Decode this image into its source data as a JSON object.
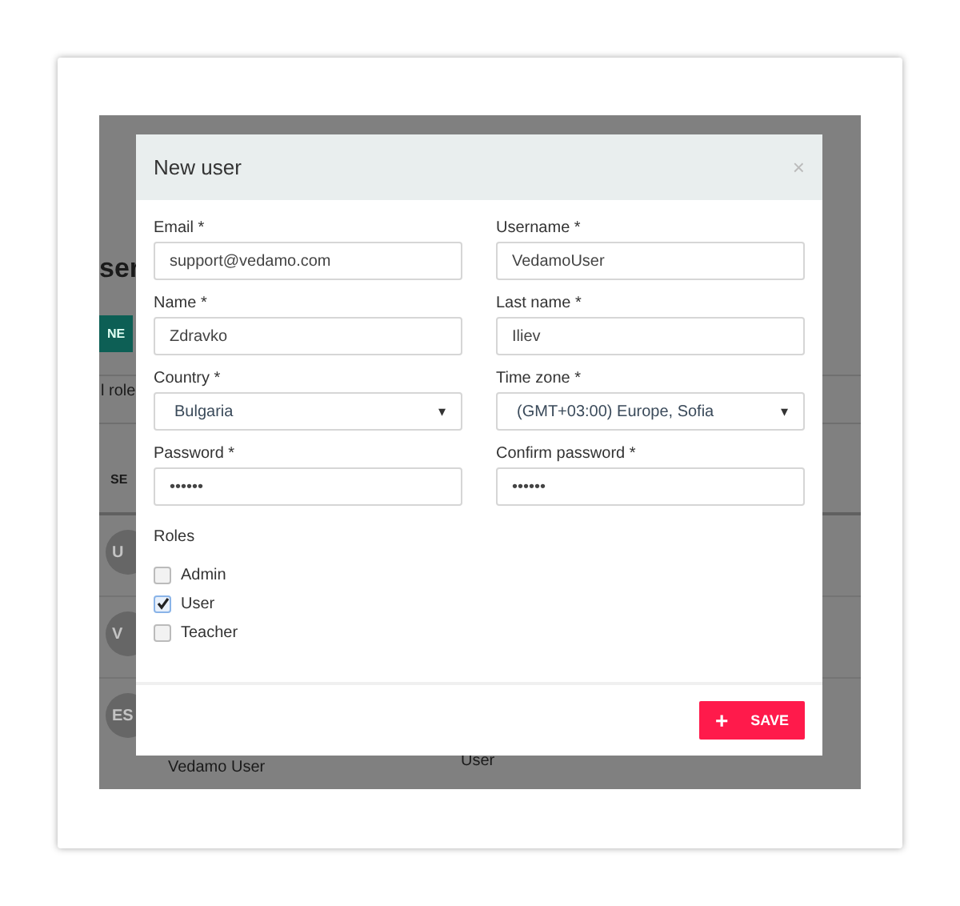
{
  "background": {
    "heading": "ser",
    "new_button": "NE",
    "filter": "l role",
    "column_header": "SE",
    "rows": [
      {
        "avatar": "U"
      },
      {
        "avatar": "V"
      },
      {
        "avatar": "ES",
        "name": "Vedamo User",
        "role": "User"
      }
    ]
  },
  "dialog": {
    "title": "New user",
    "close": "×",
    "fields": [
      {
        "label": "Email *",
        "kind": "text",
        "value": "support@vedamo.com"
      },
      {
        "label": "Username *",
        "kind": "text",
        "value": "VedamoUser"
      },
      {
        "label": "Name *",
        "kind": "text",
        "value": "Zdravko"
      },
      {
        "label": "Last name *",
        "kind": "text",
        "value": "Iliev"
      },
      {
        "label": "Country *",
        "kind": "select",
        "value": "Bulgaria",
        "caret": "▾"
      },
      {
        "label": "Time zone *",
        "kind": "select",
        "value": "(GMT+03:00) Europe, Sofia",
        "caret": "▾"
      },
      {
        "label": "Password *",
        "kind": "text",
        "value": "••••••"
      },
      {
        "label": "Confirm password *",
        "kind": "text",
        "value": "••••••"
      }
    ],
    "roles": {
      "label": "Roles",
      "items": [
        {
          "label": "Admin",
          "checked": false
        },
        {
          "label": "User",
          "checked": true
        },
        {
          "label": "Teacher",
          "checked": false
        }
      ]
    },
    "save_button": {
      "icon": "+",
      "label": "SAVE"
    }
  }
}
